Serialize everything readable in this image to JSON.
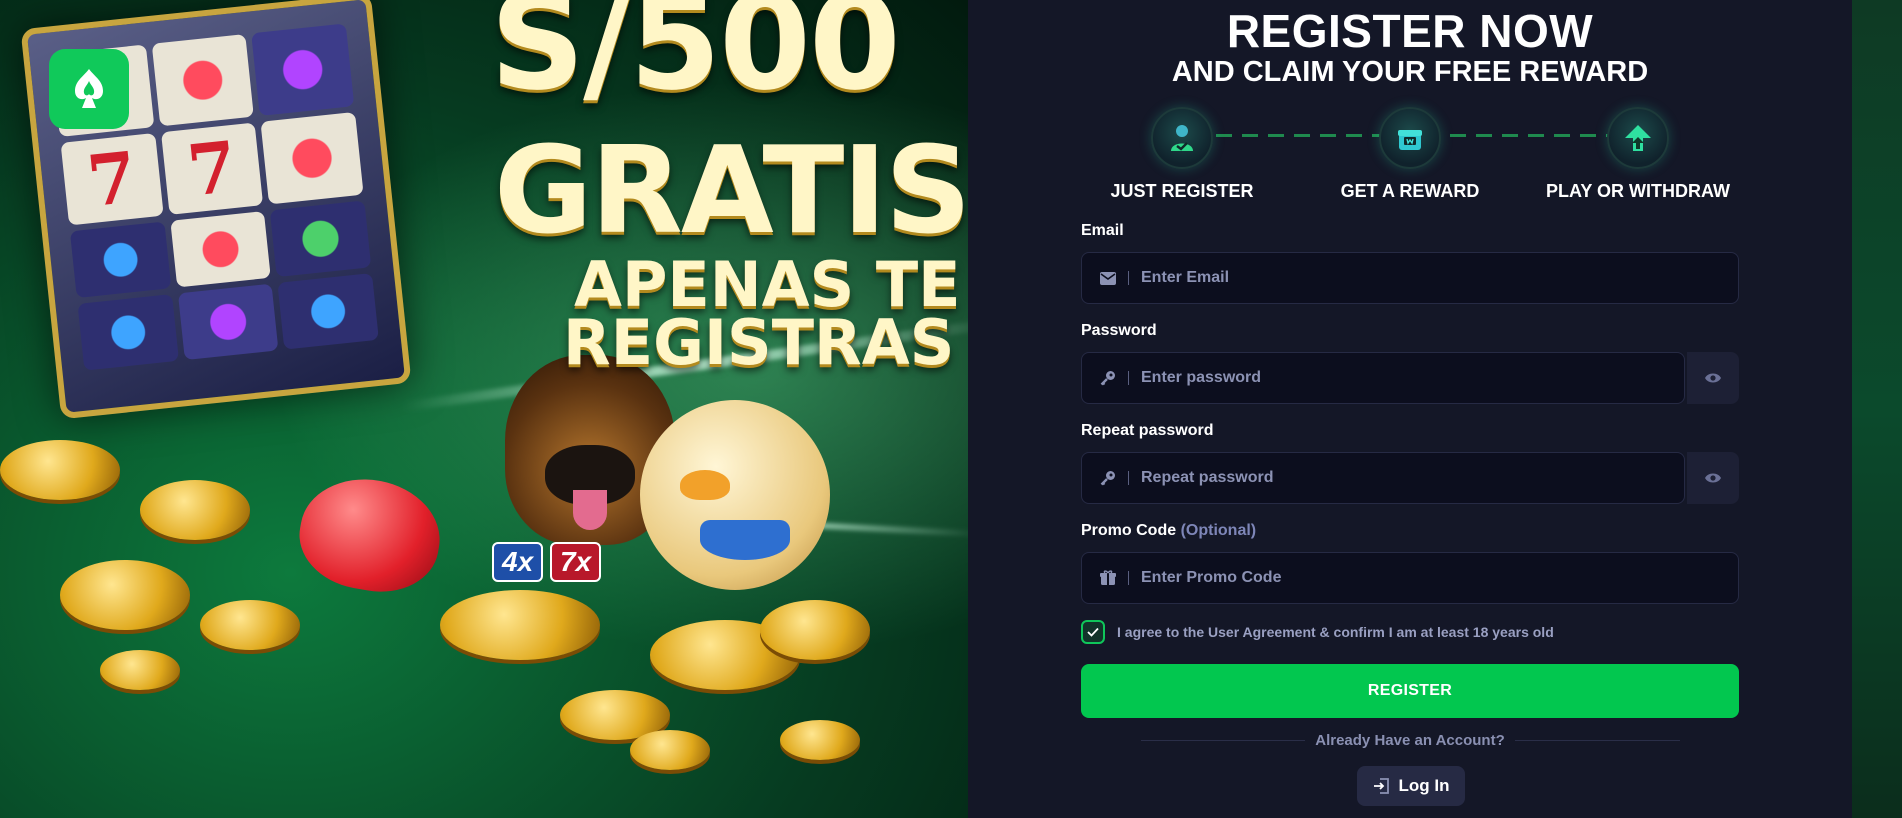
{
  "banner": {
    "headline_line1": "S/500",
    "headline_line2": "GRATIS",
    "headline_line3": "APENAS TE",
    "headline_line4": "REGISTRAS",
    "multiplier_a": "4x",
    "multiplier_b": "7x",
    "reel_symbol": "7",
    "logo_icon": "spade-flame-icon",
    "logo_color": "#10c95a"
  },
  "header": {
    "title": "REGISTER NOW",
    "subtitle": "AND CLAIM YOUR FREE REWARD"
  },
  "steps": [
    {
      "label": "JUST REGISTER",
      "icon": "user-check-icon"
    },
    {
      "label": "GET A REWARD",
      "icon": "gift-box-icon"
    },
    {
      "label": "PLAY OR WITHDRAW",
      "icon": "arrow-up-icon"
    }
  ],
  "form": {
    "email": {
      "label": "Email",
      "placeholder": "Enter Email",
      "icon": "envelope-icon"
    },
    "password": {
      "label": "Password",
      "placeholder": "Enter password",
      "icon": "key-icon"
    },
    "repeat_password": {
      "label": "Repeat password",
      "placeholder": "Repeat password",
      "icon": "key-icon"
    },
    "promo": {
      "label": "Promo Code",
      "optional": "(Optional)",
      "placeholder": "Enter Promo Code",
      "icon": "gift-icon"
    },
    "agree_text": "I agree to the User Agreement & confirm I am at least 18 years old",
    "agree_checked": true,
    "register_label": "REGISTER",
    "already_text": "Already Have an Account?",
    "login_label": "Log In"
  },
  "colors": {
    "accent_green": "#02c74f",
    "panel_bg": "#141727",
    "input_bg": "#0c0e1e"
  }
}
